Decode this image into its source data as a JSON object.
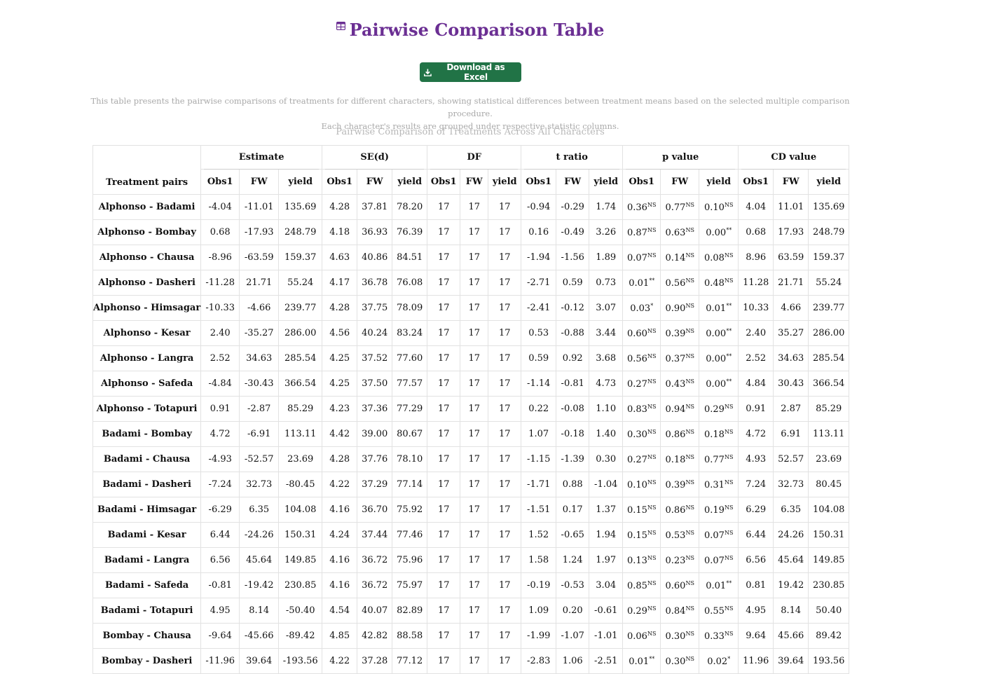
{
  "title": "Pairwise Comparison Table",
  "title_icon": "table-icon",
  "download_button": {
    "label": "Download as Excel",
    "icon": "download-icon",
    "color": "#217346"
  },
  "description_line1": "This table presents the pairwise comparisons of treatments for different characters, showing statistical differences between treatment means based on the selected multiple comparison procedure.",
  "description_line2": "Each character's results are grouped under respective statistic columns.",
  "caption": "Pairwise Comparison of Treatments Across All Characters",
  "colors": {
    "title": "#6b2f93",
    "button": "#217346",
    "muted_text": "#a9a9a9"
  },
  "table": {
    "pair_header": "Treatment pairs",
    "groups": [
      "Estimate",
      "SE(d)",
      "DF",
      "t ratio",
      "p value",
      "CD value"
    ],
    "sub_headers": [
      "Obs1",
      "FW",
      "yield"
    ],
    "rows": [
      {
        "pair": "Alphonso - Badami",
        "est": [
          "-4.04",
          "-11.01",
          "135.69"
        ],
        "se": [
          "4.28",
          "37.81",
          "78.20"
        ],
        "df": [
          "17",
          "17",
          "17"
        ],
        "t": [
          "-0.94",
          "-0.29",
          "1.74"
        ],
        "p": [
          "0.36",
          "0.77",
          "0.10"
        ],
        "sig": [
          "NS",
          "NS",
          "NS"
        ],
        "cd": [
          "4.04",
          "11.01",
          "135.69"
        ]
      },
      {
        "pair": "Alphonso - Bombay",
        "est": [
          "0.68",
          "-17.93",
          "248.79"
        ],
        "se": [
          "4.18",
          "36.93",
          "76.39"
        ],
        "df": [
          "17",
          "17",
          "17"
        ],
        "t": [
          "0.16",
          "-0.49",
          "3.26"
        ],
        "p": [
          "0.87",
          "0.63",
          "0.00"
        ],
        "sig": [
          "NS",
          "NS",
          "**"
        ],
        "cd": [
          "0.68",
          "17.93",
          "248.79"
        ]
      },
      {
        "pair": "Alphonso - Chausa",
        "est": [
          "-8.96",
          "-63.59",
          "159.37"
        ],
        "se": [
          "4.63",
          "40.86",
          "84.51"
        ],
        "df": [
          "17",
          "17",
          "17"
        ],
        "t": [
          "-1.94",
          "-1.56",
          "1.89"
        ],
        "p": [
          "0.07",
          "0.14",
          "0.08"
        ],
        "sig": [
          "NS",
          "NS",
          "NS"
        ],
        "cd": [
          "8.96",
          "63.59",
          "159.37"
        ]
      },
      {
        "pair": "Alphonso - Dasheri",
        "est": [
          "-11.28",
          "21.71",
          "55.24"
        ],
        "se": [
          "4.17",
          "36.78",
          "76.08"
        ],
        "df": [
          "17",
          "17",
          "17"
        ],
        "t": [
          "-2.71",
          "0.59",
          "0.73"
        ],
        "p": [
          "0.01",
          "0.56",
          "0.48"
        ],
        "sig": [
          "**",
          "NS",
          "NS"
        ],
        "cd": [
          "11.28",
          "21.71",
          "55.24"
        ]
      },
      {
        "pair": "Alphonso - Himsagar",
        "est": [
          "-10.33",
          "-4.66",
          "239.77"
        ],
        "se": [
          "4.28",
          "37.75",
          "78.09"
        ],
        "df": [
          "17",
          "17",
          "17"
        ],
        "t": [
          "-2.41",
          "-0.12",
          "3.07"
        ],
        "p": [
          "0.03",
          "0.90",
          "0.01"
        ],
        "sig": [
          "*",
          "NS",
          "**"
        ],
        "cd": [
          "10.33",
          "4.66",
          "239.77"
        ]
      },
      {
        "pair": "Alphonso - Kesar",
        "est": [
          "2.40",
          "-35.27",
          "286.00"
        ],
        "se": [
          "4.56",
          "40.24",
          "83.24"
        ],
        "df": [
          "17",
          "17",
          "17"
        ],
        "t": [
          "0.53",
          "-0.88",
          "3.44"
        ],
        "p": [
          "0.60",
          "0.39",
          "0.00"
        ],
        "sig": [
          "NS",
          "NS",
          "**"
        ],
        "cd": [
          "2.40",
          "35.27",
          "286.00"
        ]
      },
      {
        "pair": "Alphonso - Langra",
        "est": [
          "2.52",
          "34.63",
          "285.54"
        ],
        "se": [
          "4.25",
          "37.52",
          "77.60"
        ],
        "df": [
          "17",
          "17",
          "17"
        ],
        "t": [
          "0.59",
          "0.92",
          "3.68"
        ],
        "p": [
          "0.56",
          "0.37",
          "0.00"
        ],
        "sig": [
          "NS",
          "NS",
          "**"
        ],
        "cd": [
          "2.52",
          "34.63",
          "285.54"
        ]
      },
      {
        "pair": "Alphonso - Safeda",
        "est": [
          "-4.84",
          "-30.43",
          "366.54"
        ],
        "se": [
          "4.25",
          "37.50",
          "77.57"
        ],
        "df": [
          "17",
          "17",
          "17"
        ],
        "t": [
          "-1.14",
          "-0.81",
          "4.73"
        ],
        "p": [
          "0.27",
          "0.43",
          "0.00"
        ],
        "sig": [
          "NS",
          "NS",
          "**"
        ],
        "cd": [
          "4.84",
          "30.43",
          "366.54"
        ]
      },
      {
        "pair": "Alphonso - Totapuri",
        "est": [
          "0.91",
          "-2.87",
          "85.29"
        ],
        "se": [
          "4.23",
          "37.36",
          "77.29"
        ],
        "df": [
          "17",
          "17",
          "17"
        ],
        "t": [
          "0.22",
          "-0.08",
          "1.10"
        ],
        "p": [
          "0.83",
          "0.94",
          "0.29"
        ],
        "sig": [
          "NS",
          "NS",
          "NS"
        ],
        "cd": [
          "0.91",
          "2.87",
          "85.29"
        ]
      },
      {
        "pair": "Badami - Bombay",
        "est": [
          "4.72",
          "-6.91",
          "113.11"
        ],
        "se": [
          "4.42",
          "39.00",
          "80.67"
        ],
        "df": [
          "17",
          "17",
          "17"
        ],
        "t": [
          "1.07",
          "-0.18",
          "1.40"
        ],
        "p": [
          "0.30",
          "0.86",
          "0.18"
        ],
        "sig": [
          "NS",
          "NS",
          "NS"
        ],
        "cd": [
          "4.72",
          "6.91",
          "113.11"
        ]
      },
      {
        "pair": "Badami - Chausa",
        "est": [
          "-4.93",
          "-52.57",
          "23.69"
        ],
        "se": [
          "4.28",
          "37.76",
          "78.10"
        ],
        "df": [
          "17",
          "17",
          "17"
        ],
        "t": [
          "-1.15",
          "-1.39",
          "0.30"
        ],
        "p": [
          "0.27",
          "0.18",
          "0.77"
        ],
        "sig": [
          "NS",
          "NS",
          "NS"
        ],
        "cd": [
          "4.93",
          "52.57",
          "23.69"
        ]
      },
      {
        "pair": "Badami - Dasheri",
        "est": [
          "-7.24",
          "32.73",
          "-80.45"
        ],
        "se": [
          "4.22",
          "37.29",
          "77.14"
        ],
        "df": [
          "17",
          "17",
          "17"
        ],
        "t": [
          "-1.71",
          "0.88",
          "-1.04"
        ],
        "p": [
          "0.10",
          "0.39",
          "0.31"
        ],
        "sig": [
          "NS",
          "NS",
          "NS"
        ],
        "cd": [
          "7.24",
          "32.73",
          "80.45"
        ]
      },
      {
        "pair": "Badami - Himsagar",
        "est": [
          "-6.29",
          "6.35",
          "104.08"
        ],
        "se": [
          "4.16",
          "36.70",
          "75.92"
        ],
        "df": [
          "17",
          "17",
          "17"
        ],
        "t": [
          "-1.51",
          "0.17",
          "1.37"
        ],
        "p": [
          "0.15",
          "0.86",
          "0.19"
        ],
        "sig": [
          "NS",
          "NS",
          "NS"
        ],
        "cd": [
          "6.29",
          "6.35",
          "104.08"
        ]
      },
      {
        "pair": "Badami - Kesar",
        "est": [
          "6.44",
          "-24.26",
          "150.31"
        ],
        "se": [
          "4.24",
          "37.44",
          "77.46"
        ],
        "df": [
          "17",
          "17",
          "17"
        ],
        "t": [
          "1.52",
          "-0.65",
          "1.94"
        ],
        "p": [
          "0.15",
          "0.53",
          "0.07"
        ],
        "sig": [
          "NS",
          "NS",
          "NS"
        ],
        "cd": [
          "6.44",
          "24.26",
          "150.31"
        ]
      },
      {
        "pair": "Badami - Langra",
        "est": [
          "6.56",
          "45.64",
          "149.85"
        ],
        "se": [
          "4.16",
          "36.72",
          "75.96"
        ],
        "df": [
          "17",
          "17",
          "17"
        ],
        "t": [
          "1.58",
          "1.24",
          "1.97"
        ],
        "p": [
          "0.13",
          "0.23",
          "0.07"
        ],
        "sig": [
          "NS",
          "NS",
          "NS"
        ],
        "cd": [
          "6.56",
          "45.64",
          "149.85"
        ]
      },
      {
        "pair": "Badami - Safeda",
        "est": [
          "-0.81",
          "-19.42",
          "230.85"
        ],
        "se": [
          "4.16",
          "36.72",
          "75.97"
        ],
        "df": [
          "17",
          "17",
          "17"
        ],
        "t": [
          "-0.19",
          "-0.53",
          "3.04"
        ],
        "p": [
          "0.85",
          "0.60",
          "0.01"
        ],
        "sig": [
          "NS",
          "NS",
          "**"
        ],
        "cd": [
          "0.81",
          "19.42",
          "230.85"
        ]
      },
      {
        "pair": "Badami - Totapuri",
        "est": [
          "4.95",
          "8.14",
          "-50.40"
        ],
        "se": [
          "4.54",
          "40.07",
          "82.89"
        ],
        "df": [
          "17",
          "17",
          "17"
        ],
        "t": [
          "1.09",
          "0.20",
          "-0.61"
        ],
        "p": [
          "0.29",
          "0.84",
          "0.55"
        ],
        "sig": [
          "NS",
          "NS",
          "NS"
        ],
        "cd": [
          "4.95",
          "8.14",
          "50.40"
        ]
      },
      {
        "pair": "Bombay - Chausa",
        "est": [
          "-9.64",
          "-45.66",
          "-89.42"
        ],
        "se": [
          "4.85",
          "42.82",
          "88.58"
        ],
        "df": [
          "17",
          "17",
          "17"
        ],
        "t": [
          "-1.99",
          "-1.07",
          "-1.01"
        ],
        "p": [
          "0.06",
          "0.30",
          "0.33"
        ],
        "sig": [
          "NS",
          "NS",
          "NS"
        ],
        "cd": [
          "9.64",
          "45.66",
          "89.42"
        ]
      },
      {
        "pair": "Bombay - Dasheri",
        "est": [
          "-11.96",
          "39.64",
          "-193.56"
        ],
        "se": [
          "4.22",
          "37.28",
          "77.12"
        ],
        "df": [
          "17",
          "17",
          "17"
        ],
        "t": [
          "-2.83",
          "1.06",
          "-2.51"
        ],
        "p": [
          "0.01",
          "0.30",
          "0.02"
        ],
        "sig": [
          "**",
          "NS",
          "*"
        ],
        "cd": [
          "11.96",
          "39.64",
          "193.56"
        ]
      }
    ]
  }
}
